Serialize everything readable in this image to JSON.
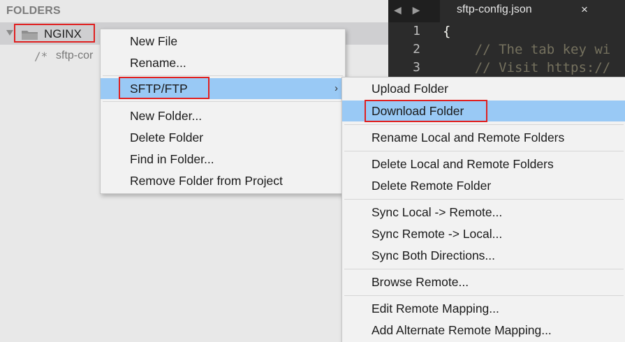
{
  "sidebar": {
    "header": "FOLDERS",
    "folder": {
      "name": "NGINX",
      "icon": "folder-icon"
    },
    "file": {
      "prefix": "/*",
      "name": "sftp-cor"
    }
  },
  "editor": {
    "tab": {
      "title": "sftp-config.json",
      "close": "×",
      "nav": "◀ ▶"
    },
    "line_numbers": [
      "1",
      "2",
      "3"
    ],
    "lines": [
      "{",
      "    // The tab key wi",
      "    // Visit https://"
    ]
  },
  "context_menu": {
    "items": [
      {
        "label": "New File"
      },
      {
        "label": "Rename..."
      },
      {
        "label": "SFTP/FTP",
        "submenu_arrow": "›"
      },
      {
        "label": "New Folder..."
      },
      {
        "label": "Delete Folder"
      },
      {
        "label": "Find in Folder..."
      },
      {
        "label": "Remove Folder from Project"
      }
    ]
  },
  "submenu": {
    "items": [
      {
        "label": "Upload Folder"
      },
      {
        "label": "Download Folder"
      },
      {
        "label": "Rename Local and Remote Folders"
      },
      {
        "label": "Delete Local and Remote Folders"
      },
      {
        "label": "Delete Remote Folder"
      },
      {
        "label": "Sync Local -> Remote..."
      },
      {
        "label": "Sync Remote -> Local..."
      },
      {
        "label": "Sync Both Directions..."
      },
      {
        "label": "Browse Remote..."
      },
      {
        "label": "Edit Remote Mapping..."
      },
      {
        "label": "Add Alternate Remote Mapping..."
      }
    ]
  },
  "colors": {
    "highlight": "#99c9f5",
    "annotation_box": "#e02020",
    "editor_bg": "#2b2b2b"
  }
}
